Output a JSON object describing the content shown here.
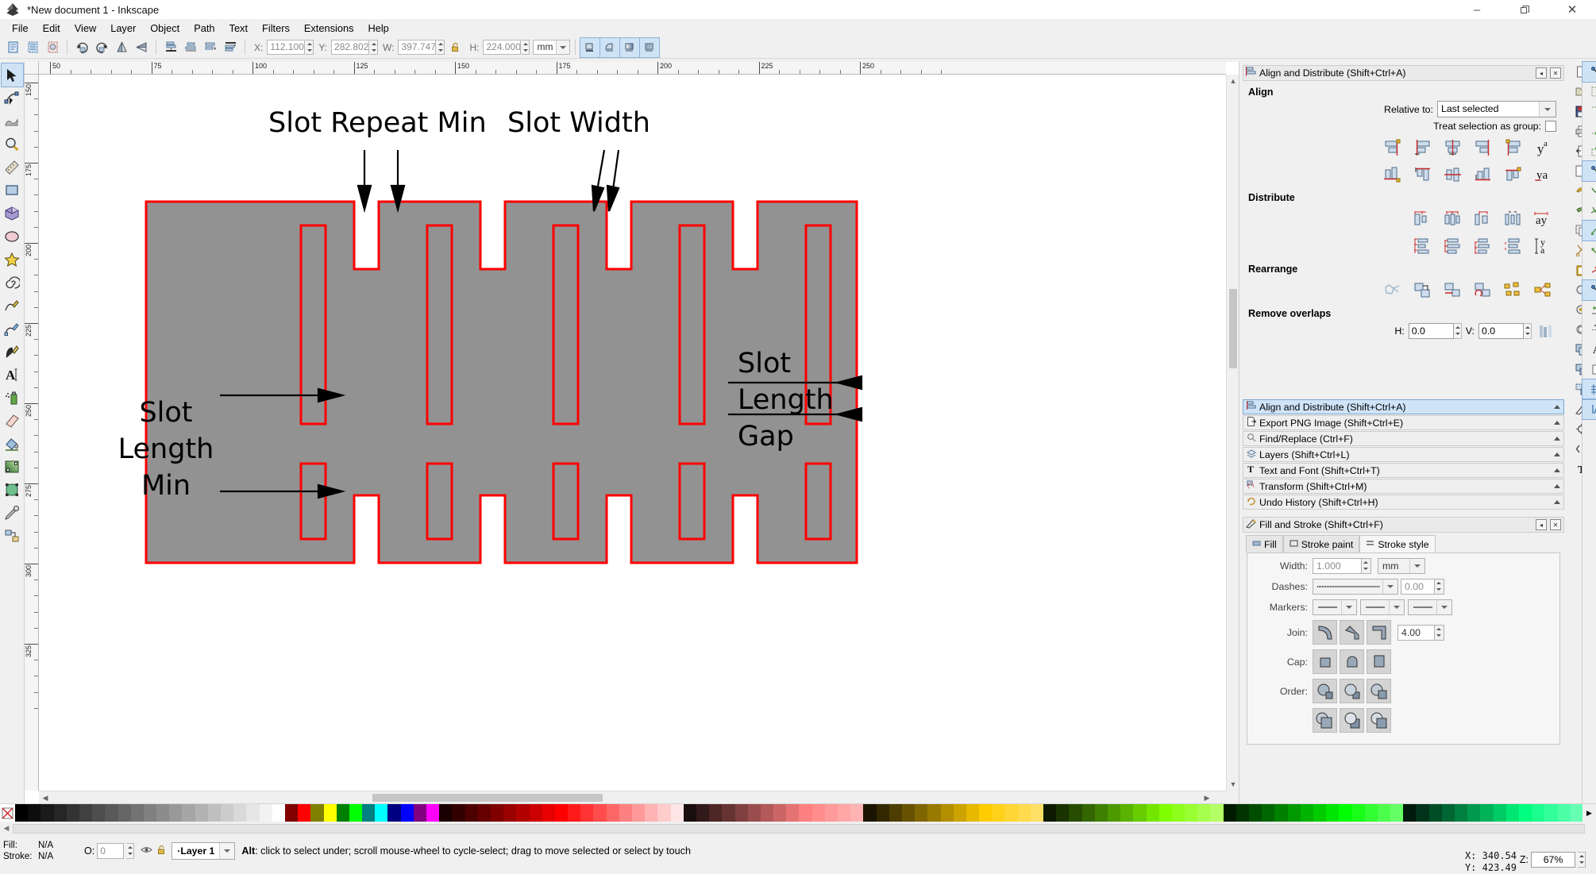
{
  "window": {
    "title": "*New document 1 - Inkscape",
    "app_icon": "inkscape-logo-icon",
    "minimize": "–",
    "maximize": "❐",
    "close": "✕"
  },
  "menubar": [
    {
      "label": "File",
      "mnemonic": "F"
    },
    {
      "label": "Edit",
      "mnemonic": "E"
    },
    {
      "label": "View",
      "mnemonic": "V"
    },
    {
      "label": "Layer",
      "mnemonic": "L"
    },
    {
      "label": "Object",
      "mnemonic": "O"
    },
    {
      "label": "Path",
      "mnemonic": "P"
    },
    {
      "label": "Text",
      "mnemonic": "T"
    },
    {
      "label": "Filters",
      "mnemonic": "s"
    },
    {
      "label": "Extensions",
      "mnemonic": "n"
    },
    {
      "label": "Help",
      "mnemonic": "H"
    }
  ],
  "toolbar": {
    "x_label": "X:",
    "x_value": "112.100",
    "y_label": "Y:",
    "y_value": "282.802",
    "w_label": "W:",
    "w_value": "397.747",
    "h_label": "H:",
    "h_value": "224.000",
    "lock_icon": "lock-open-icon",
    "unit_value": "mm",
    "icons": [
      "select-all-icon",
      "select-all-in-all-layers-icon",
      "deselect-icon",
      "rotate-90-ccw-icon",
      "rotate-90-cw-icon",
      "flip-horizontal-icon",
      "flip-vertical-icon",
      "raise-to-top-icon",
      "raise-icon",
      "lower-icon",
      "lower-to-bottom-icon"
    ],
    "affect_icons": [
      "transform-stroke-icon",
      "transform-corners-icon",
      "transform-gradients-icon",
      "transform-patterns-icon"
    ]
  },
  "toolbox": [
    {
      "name": "selector-tool",
      "icon": "arrow-cursor-icon",
      "selected": true
    },
    {
      "name": "node-tool",
      "icon": "node-editor-icon",
      "selected": false
    },
    {
      "name": "tweak-tool",
      "icon": "tweak-icon",
      "selected": false
    },
    {
      "name": "zoom-tool",
      "icon": "magnifier-icon",
      "selected": false
    },
    {
      "name": "measure-tool",
      "icon": "ruler-icon",
      "selected": false
    },
    {
      "name": "rectangle-tool",
      "icon": "rectangle-icon",
      "selected": false
    },
    {
      "name": "box3d-tool",
      "icon": "cube-icon",
      "selected": false
    },
    {
      "name": "ellipse-tool",
      "icon": "ellipse-icon",
      "selected": false
    },
    {
      "name": "star-tool",
      "icon": "star-icon",
      "selected": false
    },
    {
      "name": "spiral-tool",
      "icon": "spiral-icon",
      "selected": false
    },
    {
      "name": "pencil-tool",
      "icon": "pencil-icon",
      "selected": false
    },
    {
      "name": "bezier-tool",
      "icon": "bezier-pen-icon",
      "selected": false
    },
    {
      "name": "calligraphy-tool",
      "icon": "calligraphy-pen-icon",
      "selected": false
    },
    {
      "name": "text-tool",
      "icon": "text-a-icon",
      "selected": false
    },
    {
      "name": "spray-tool",
      "icon": "spray-can-icon",
      "selected": false
    },
    {
      "name": "eraser-tool",
      "icon": "eraser-icon",
      "selected": false
    },
    {
      "name": "paint-bucket-tool",
      "icon": "paint-bucket-icon",
      "selected": false
    },
    {
      "name": "gradient-tool",
      "icon": "gradient-icon",
      "selected": false
    },
    {
      "name": "mesh-tool",
      "icon": "mesh-gradient-icon",
      "selected": false
    },
    {
      "name": "dropper-tool",
      "icon": "eyedropper-icon",
      "selected": false
    },
    {
      "name": "connector-tool",
      "icon": "connector-icon",
      "selected": false
    }
  ],
  "canvas": {
    "ruler_unit": "mm",
    "h_ruler_labels": [
      "50",
      "75",
      "100",
      "125",
      "150",
      "175",
      "200",
      "225",
      "250"
    ],
    "v_ruler_labels": [
      "150",
      "175",
      "200",
      "225",
      "250",
      "275",
      "300",
      "325"
    ],
    "annotations": [
      {
        "name": "slot-repeat-min-label",
        "text": "Slot Repeat Min"
      },
      {
        "name": "slot-width-label",
        "text": "Slot Width"
      },
      {
        "name": "slot-length-min-label",
        "lines": [
          "Slot",
          "Length",
          "Min"
        ]
      },
      {
        "name": "slot-length-gap-label",
        "lines": [
          "Slot",
          "Length",
          "Gap"
        ]
      }
    ],
    "drawing": {
      "fill_color": "#929292",
      "stroke_color": "#ff0000",
      "description": "interlocking-slot-pattern"
    }
  },
  "align_panel": {
    "title": "Align and Distribute (Shift+Ctrl+A)",
    "title_icon": "align-icon",
    "collapse_icon": "◂",
    "close_icon": "✕",
    "align_heading": "Align",
    "relative_to_label": "Relative to:",
    "relative_to_value": "Last selected",
    "treat_as_group_label": "Treat selection as group:",
    "treat_as_group_checked": false,
    "align_row1": [
      "align-right-edge-to-left-icon",
      "align-left-edges-icon",
      "center-on-vertical-axis-icon",
      "align-right-edges-icon",
      "align-left-edge-to-right-icon",
      "text-anchor-vertical-icon"
    ],
    "align_row2": [
      "align-bottom-edge-to-top-icon",
      "align-top-edges-icon",
      "center-on-horizontal-axis-icon",
      "align-bottom-edges-icon",
      "align-top-edge-to-bottom-icon",
      "text-baseline-horizontal-icon"
    ],
    "distribute_heading": "Distribute",
    "distribute_row1": [
      "distribute-left-edges-icon",
      "distribute-centers-horizontally-icon",
      "distribute-right-edges-icon",
      "distribute-gaps-horizontally-icon",
      "distribute-text-anchors-horizontally-icon"
    ],
    "distribute_row2": [
      "distribute-top-edges-icon",
      "distribute-centers-vertically-icon",
      "distribute-bottom-edges-icon",
      "distribute-gaps-vertically-icon",
      "distribute-text-baselines-vertically-icon"
    ],
    "rearrange_heading": "Rearrange",
    "rearrange_icons": [
      "nodes-shortest-path-icon",
      "exchange-positions-icon",
      "exchange-positions-zorder-icon",
      "exchange-positions-clockwise-icon",
      "randomize-positions-icon",
      "unclump-objects-icon"
    ],
    "remove_overlaps_heading": "Remove overlaps",
    "h_label": "H:",
    "h_value": "0.0",
    "v_label": "V:",
    "v_value": "0.0",
    "remove_overlaps_icon": "remove-overlaps-icon"
  },
  "dialog_list": [
    {
      "label": "Align and Distribute (Shift+Ctrl+A)",
      "icon": "align-icon",
      "active": true
    },
    {
      "label": "Export PNG Image (Shift+Ctrl+E)",
      "icon": "export-png-icon",
      "active": false
    },
    {
      "label": "Find/Replace (Ctrl+F)",
      "icon": "magnifier-icon",
      "active": false
    },
    {
      "label": "Layers (Shift+Ctrl+L)",
      "icon": "layers-icon",
      "active": false
    },
    {
      "label": "Text and Font (Shift+Ctrl+T)",
      "icon": "text-t-icon",
      "active": false
    },
    {
      "label": "Transform (Shift+Ctrl+M)",
      "icon": "transform-icon",
      "active": false
    },
    {
      "label": "Undo History (Shift+Ctrl+H)",
      "icon": "undo-history-icon",
      "active": false
    }
  ],
  "fill_stroke_panel": {
    "title": "Fill and Stroke (Shift+Ctrl+F)",
    "title_icon": "fill-stroke-icon",
    "collapse_icon": "◂",
    "close_icon": "✕",
    "tabs": [
      {
        "label": "Fill",
        "icon": "fill-swatch-icon",
        "selected": false
      },
      {
        "label": "Stroke paint",
        "icon": "stroke-paint-icon",
        "selected": false
      },
      {
        "label": "Stroke style",
        "icon": "stroke-style-icon",
        "selected": true
      }
    ],
    "width_label": "Width:",
    "width_value": "1.000",
    "width_unit": "mm",
    "dashes_label": "Dashes:",
    "dash_offset_value": "0.00",
    "markers_label": "Markers:",
    "join_label": "Join:",
    "miter_value": "4.00",
    "join_icons": [
      "join-round-icon",
      "join-bevel-icon",
      "join-miter-icon"
    ],
    "cap_label": "Cap:",
    "cap_icons": [
      "cap-butt-icon",
      "cap-round-icon",
      "cap-square-icon"
    ],
    "order_label": "Order:",
    "order_icons_row1": [
      "paint-order-fmp-icon",
      "paint-order-fpm-icon",
      "paint-order-mfp-icon"
    ],
    "order_icons_row2": [
      "paint-order-mpf-icon",
      "paint-order-pfm-icon",
      "paint-order-pmf-icon"
    ]
  },
  "command_bar": [
    {
      "name": "new-document-button",
      "icon": "new-file-icon"
    },
    {
      "name": "open-document-button",
      "icon": "folder-open-icon"
    },
    {
      "name": "save-document-button",
      "icon": "floppy-save-icon"
    },
    {
      "name": "print-document-button",
      "icon": "printer-icon"
    },
    {
      "name": "import-button",
      "icon": "import-icon"
    },
    {
      "name": "export-button",
      "icon": "export-icon"
    },
    {
      "name": "undo-button",
      "icon": "undo-arrow-icon"
    },
    {
      "name": "redo-button",
      "icon": "redo-arrow-icon"
    },
    {
      "name": "copy-button",
      "icon": "copy-icon"
    },
    {
      "name": "cut-button",
      "icon": "scissors-icon"
    },
    {
      "name": "paste-button",
      "icon": "clipboard-paste-icon"
    },
    {
      "name": "zoom-selection-button",
      "icon": "zoom-selection-icon"
    },
    {
      "name": "zoom-drawing-button",
      "icon": "zoom-drawing-icon"
    },
    {
      "name": "zoom-page-button",
      "icon": "zoom-page-icon"
    },
    {
      "name": "duplicate-button",
      "icon": "duplicate-icon"
    },
    {
      "name": "group-button",
      "icon": "group-icon"
    },
    {
      "name": "ungroup-button",
      "icon": "ungroup-icon"
    },
    {
      "name": "fill-stroke-dialog-button",
      "icon": "fill-stroke-icon"
    },
    {
      "name": "object-properties-button",
      "icon": "object-properties-icon"
    },
    {
      "name": "xml-editor-button",
      "icon": "xml-editor-icon"
    },
    {
      "name": "text-font-dialog-button",
      "icon": "text-t-icon"
    }
  ],
  "snap_bar": [
    {
      "name": "enable-snapping-toggle",
      "icon": "snap-master-icon",
      "on": true
    },
    {
      "name": "snap-bounding-box-toggle",
      "icon": "snap-bbox-icon",
      "on": false
    },
    {
      "name": "snap-bbox-corner-toggle",
      "icon": "snap-bbox-corner-icon",
      "on": false
    },
    {
      "name": "snap-bbox-edge-midpoint-toggle",
      "icon": "snap-bbox-edge-mid-icon",
      "on": false
    },
    {
      "name": "snap-bbox-center-toggle",
      "icon": "snap-bbox-center-icon",
      "on": false
    },
    {
      "name": "snap-nodes-toggle",
      "icon": "snap-nodes-icon",
      "on": true
    },
    {
      "name": "snap-paths-toggle",
      "icon": "snap-path-icon",
      "on": false
    },
    {
      "name": "snap-path-intersection-toggle",
      "icon": "snap-path-intersection-icon",
      "on": false
    },
    {
      "name": "snap-cusp-nodes-toggle",
      "icon": "snap-cusp-node-icon",
      "on": true
    },
    {
      "name": "snap-smooth-nodes-toggle",
      "icon": "snap-smooth-node-icon",
      "on": false
    },
    {
      "name": "snap-midpoints-toggle",
      "icon": "snap-midpoint-icon",
      "on": false
    },
    {
      "name": "snap-others-toggle",
      "icon": "snap-others-icon",
      "on": true
    },
    {
      "name": "snap-object-center-toggle",
      "icon": "snap-object-center-icon",
      "on": false
    },
    {
      "name": "snap-rotation-center-toggle",
      "icon": "snap-rotation-center-icon",
      "on": false
    },
    {
      "name": "snap-text-baseline-toggle",
      "icon": "snap-text-baseline-icon",
      "on": false
    },
    {
      "name": "snap-page-border-toggle",
      "icon": "snap-page-border-icon",
      "on": false
    },
    {
      "name": "snap-grid-toggle",
      "icon": "snap-grid-icon",
      "on": true
    },
    {
      "name": "snap-guide-toggle",
      "icon": "snap-guide-icon",
      "on": true
    }
  ],
  "palette": {
    "remove_color_icon": "no-color-x-icon",
    "colors": [
      "#000000",
      "#0d0d0d",
      "#1a1a1a",
      "#262626",
      "#333333",
      "#404040",
      "#4d4d4d",
      "#595959",
      "#666666",
      "#737373",
      "#808080",
      "#8c8c8c",
      "#999999",
      "#a6a6a6",
      "#b3b3b3",
      "#bfbfbf",
      "#cccccc",
      "#d9d9d9",
      "#e6e6e6",
      "#f2f2f2",
      "#ffffff",
      "#800000",
      "#ff0000",
      "#808000",
      "#ffff00",
      "#008000",
      "#00ff00",
      "#008080",
      "#00ffff",
      "#000080",
      "#0000ff",
      "#800080",
      "#ff00ff",
      "#1a0000",
      "#330000",
      "#4d0000",
      "#660000",
      "#800000",
      "#990000",
      "#b30000",
      "#cc0000",
      "#e60000",
      "#ff0000",
      "#ff1a1a",
      "#ff3333",
      "#ff4d4d",
      "#ff6666",
      "#ff8080",
      "#ff9999",
      "#ffb3b3",
      "#ffcccc",
      "#ffe6e6",
      "#1a0d0d",
      "#331a1a",
      "#4d2626",
      "#663333",
      "#804040",
      "#994d4d",
      "#b35959",
      "#cc6666",
      "#e67373",
      "#ff8080",
      "#ff8d8d",
      "#ff9a9a",
      "#ffa7a7",
      "#ffb4b4",
      "#1a1400",
      "#332900",
      "#4d3d00",
      "#665200",
      "#806600",
      "#997a00",
      "#b38f00",
      "#cca300",
      "#e6b800",
      "#ffcc00",
      "#ffd11a",
      "#ffd633",
      "#ffdb4d",
      "#ffe066",
      "#0d1a00",
      "#1a3300",
      "#264d00",
      "#336600",
      "#408000",
      "#4d9900",
      "#59b300",
      "#66cc00",
      "#73e600",
      "#80ff00",
      "#8dff1a",
      "#9aff33",
      "#a7ff4d",
      "#b4ff66",
      "#001a00",
      "#003300",
      "#004d00",
      "#006600",
      "#008000",
      "#009900",
      "#00b300",
      "#00cc00",
      "#00e600",
      "#00ff00",
      "#1aff1a",
      "#33ff33",
      "#4dff4d",
      "#66ff66",
      "#001a0d",
      "#00331a",
      "#004d26",
      "#006633",
      "#008040",
      "#00994d",
      "#00b359",
      "#00cc66",
      "#00e673",
      "#00ff80",
      "#1aff8d",
      "#33ff9a",
      "#4dffa7",
      "#66ffb4"
    ]
  },
  "status": {
    "fill_label": "Fill:",
    "fill_value": "N/A",
    "stroke_label": "Stroke:",
    "stroke_value": "N/A",
    "opacity_label": "O:",
    "opacity_value": "0",
    "visibility_icon": "eye-icon",
    "lock_icon": "lock-open-icon",
    "layer_name": "Layer 1",
    "layer_indicator": "·",
    "hint_bold": "Alt",
    "hint_text": ": click to select under; scroll mouse-wheel to cycle-select; drag to move selected or select by touch",
    "x_label": "X:",
    "x_value": "340.54",
    "y_label": "Y:",
    "y_value": "423.49",
    "zoom_label": "Z:",
    "zoom_value": "67%"
  }
}
